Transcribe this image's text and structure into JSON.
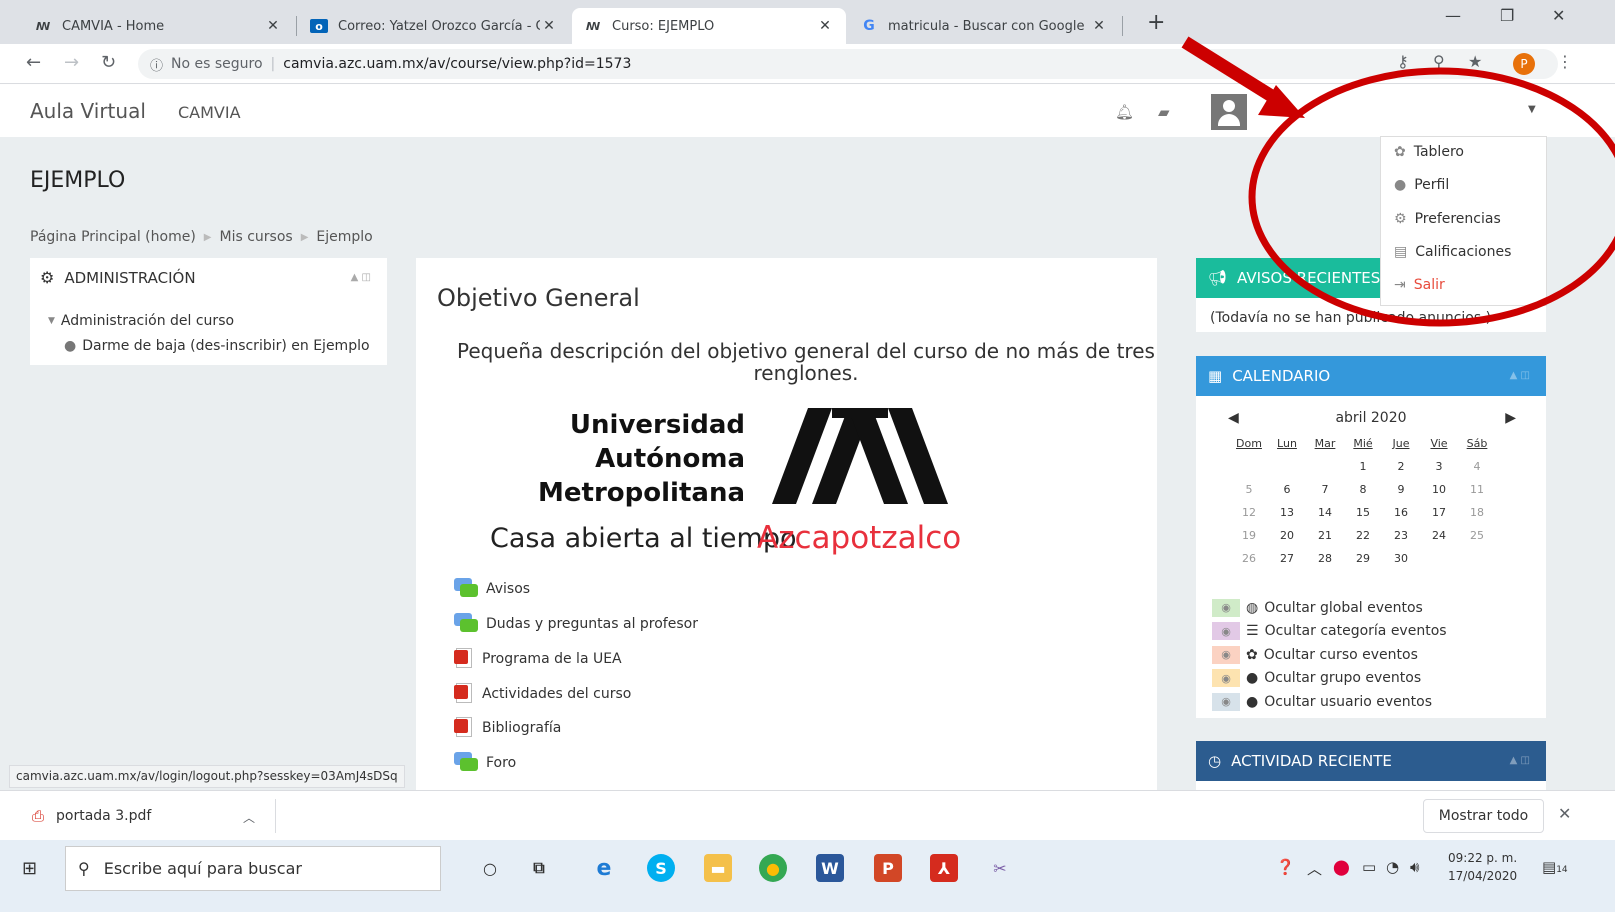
{
  "browser": {
    "tabs": [
      {
        "title": "CAMVIA - Home",
        "favicon": "uam-logo-icon"
      },
      {
        "title": "Correo: Yatzel Orozco García - Ou",
        "favicon": "outlook-icon"
      },
      {
        "title": "Curso: EJEMPLO",
        "favicon": "uam-logo-icon"
      },
      {
        "title": "matricula - Buscar con Google",
        "favicon": "google-icon"
      }
    ],
    "address": {
      "security": "No es seguro",
      "url": "camvia.azc.uam.mx/av/course/view.php?id=1573"
    },
    "profile_initial": "P"
  },
  "navbar": {
    "brand": "Aula Virtual",
    "site": "CAMVIA"
  },
  "course": {
    "title": "EJEMPLO",
    "breadcrumb": [
      "Página Principal (home)",
      "Mis cursos",
      "Ejemplo"
    ]
  },
  "admin": {
    "title": "ADMINISTRACIÓN",
    "item1": "Administración del curso",
    "item2": "Darme de baja (des-inscribir) en Ejemplo"
  },
  "main": {
    "heading": "Objetivo General",
    "description": "Pequeña descripción del objetivo general del curso de no más de tres renglones.",
    "logo_lines": [
      "Universidad",
      "Autónoma",
      "Metropolitana"
    ],
    "logo_sub": "Casa abierta al tiempo",
    "logo_campus": "Azcapotzalco",
    "resources": [
      {
        "label": "Avisos",
        "icon": "forum-icon"
      },
      {
        "label": "Dudas y preguntas al profesor",
        "icon": "forum-icon"
      },
      {
        "label": "Programa de la UEA",
        "icon": "pdf-icon"
      },
      {
        "label": "Actividades del curso",
        "icon": "pdf-icon"
      },
      {
        "label": "Bibliografía",
        "icon": "pdf-icon"
      },
      {
        "label": "Foro",
        "icon": "forum-icon"
      }
    ]
  },
  "avisos": {
    "title": "AVISOS RECIENTES",
    "text": "(Todavía no se han publicado anuncios.)"
  },
  "calendar": {
    "title": "CALENDARIO",
    "month": "abril 2020",
    "days": [
      "Dom",
      "Lun",
      "Mar",
      "Mié",
      "Jue",
      "Vie",
      "Sáb"
    ],
    "weeks": [
      [
        "",
        "",
        "",
        "1",
        "2",
        "3",
        "4"
      ],
      [
        "5",
        "6",
        "7",
        "8",
        "9",
        "10",
        "11"
      ],
      [
        "12",
        "13",
        "14",
        "15",
        "16",
        "17",
        "18"
      ],
      [
        "19",
        "20",
        "21",
        "22",
        "23",
        "24",
        "25"
      ],
      [
        "26",
        "27",
        "28",
        "29",
        "30",
        "",
        ""
      ]
    ],
    "legend": [
      {
        "label": "Ocultar global eventos",
        "color": "#d0ebc8"
      },
      {
        "label": "Ocultar categoría eventos",
        "color": "#e2c9e6"
      },
      {
        "label": "Ocultar curso eventos",
        "color": "#fbd2c2"
      },
      {
        "label": "Ocultar grupo eventos",
        "color": "#fde3b0"
      },
      {
        "label": "Ocultar usuario eventos",
        "color": "#d7e2ea"
      }
    ]
  },
  "activity": {
    "title": "ACTIVIDAD RECIENTE"
  },
  "user_menu": [
    "Tablero",
    "Perfil",
    "Preferencias",
    "Calificaciones",
    "Salir"
  ],
  "status_url": "camvia.azc.uam.mx/av/login/logout.php?sesskey=03AmJ4sDSq",
  "download": {
    "file": "portada 3.pdf",
    "show_all": "Mostrar todo"
  },
  "taskbar": {
    "search_placeholder": "Escribe aquí para buscar",
    "time": "09:22 p. m.",
    "date": "17/04/2020",
    "notifications": "14"
  },
  "colors": {
    "accent_teal": "#1abc9c",
    "accent_blue": "#3498db",
    "annotation_red": "#cc0000"
  }
}
